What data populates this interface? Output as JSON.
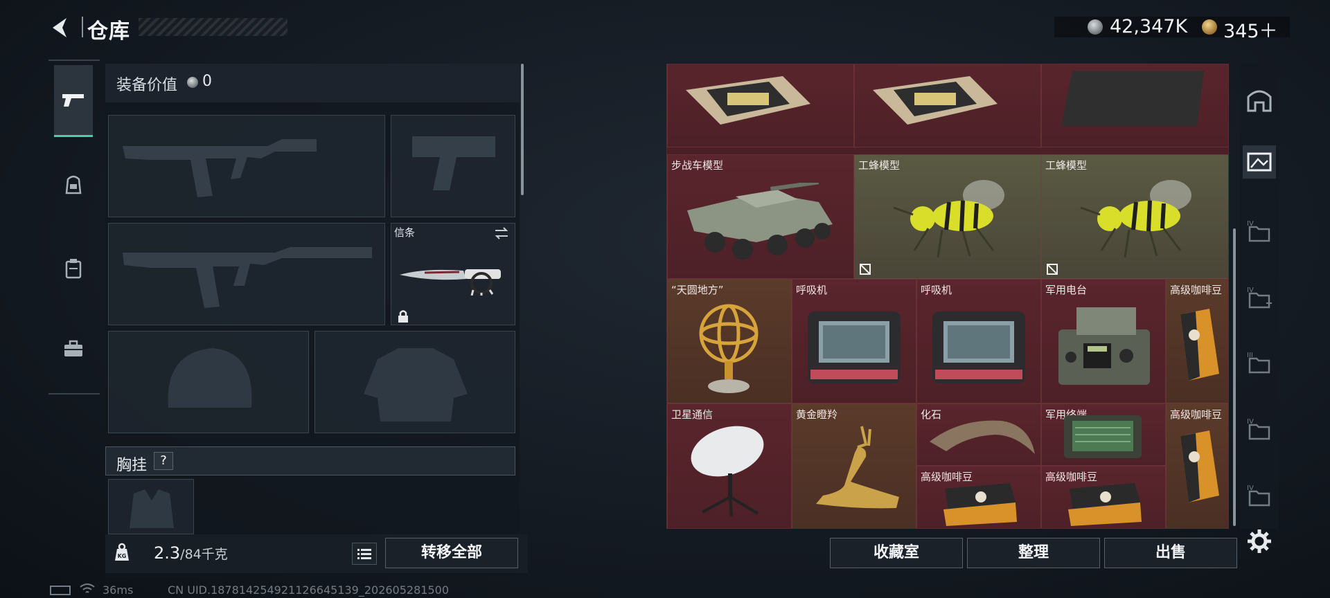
{
  "header": {
    "title": "仓库",
    "currency_primary": "42,347K",
    "currency_secondary": "345＋"
  },
  "left_tabs": [
    {
      "name": "weapons",
      "icon": "pistol-icon"
    },
    {
      "name": "armor",
      "icon": "helmet-bag-icon"
    },
    {
      "name": "vest",
      "icon": "vest-icon"
    },
    {
      "name": "case",
      "icon": "briefcase-icon"
    }
  ],
  "equipment": {
    "value_label": "装备价值",
    "value": "0",
    "melee_label": "信条",
    "chest_rig_label": "胸挂",
    "help": "?",
    "weight_current": "2.3",
    "weight_max": "/84千克",
    "transfer_all": "转移全部"
  },
  "stash": {
    "items": [
      {
        "label": "",
        "icon": "gpu-icon"
      },
      {
        "label": "",
        "icon": "gpu-icon"
      },
      {
        "label": "",
        "icon": "cloth-icon"
      },
      {
        "label": "步战车模型",
        "icon": "ifv-model-icon"
      },
      {
        "label": "工蜂模型",
        "icon": "wasp-model-icon"
      },
      {
        "label": "工蜂模型",
        "icon": "wasp-model-icon"
      },
      {
        "label": "“天圆地方”",
        "icon": "armillary-sphere-icon"
      },
      {
        "label": "呼吸机",
        "icon": "ventilator-icon"
      },
      {
        "label": "呼吸机",
        "icon": "ventilator-icon"
      },
      {
        "label": "军用电台",
        "icon": "military-radio-icon"
      },
      {
        "label": "高级咖啡豆",
        "icon": "coffee-bag-icon"
      },
      {
        "label": "卫星通信",
        "icon": "satellite-dish-icon"
      },
      {
        "label": "黄金瞪羚",
        "icon": "gold-gazelle-icon"
      },
      {
        "label": "化石",
        "icon": "fossil-claw-icon"
      },
      {
        "label": "军用终端",
        "icon": "military-terminal-icon"
      },
      {
        "label": "高级咖啡豆",
        "icon": "coffee-bag-icon"
      },
      {
        "label": "高级咖啡豆",
        "icon": "coffee-pack-icon"
      },
      {
        "label": "高级咖啡豆",
        "icon": "coffee-pack-icon"
      }
    ],
    "buttons": {
      "collection": "收藏室",
      "sort": "整理",
      "sell": "出售"
    }
  },
  "status": {
    "ping": "36ms",
    "uid": "CN UID.18781425492112664513​9_202605281500"
  }
}
